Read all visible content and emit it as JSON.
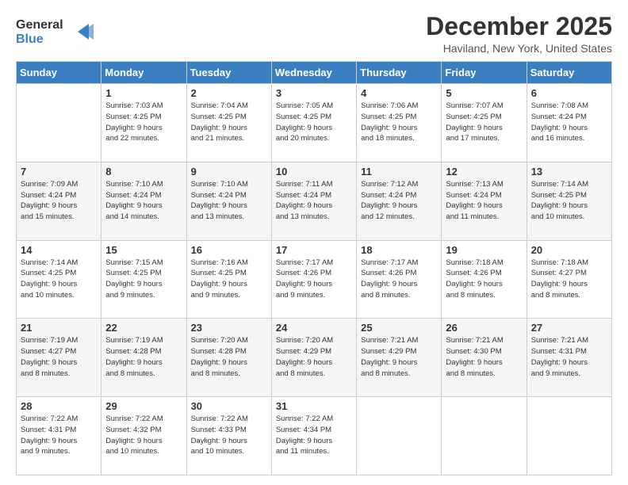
{
  "logo": {
    "line1": "General",
    "line2": "Blue"
  },
  "title": "December 2025",
  "subtitle": "Haviland, New York, United States",
  "days_of_week": [
    "Sunday",
    "Monday",
    "Tuesday",
    "Wednesday",
    "Thursday",
    "Friday",
    "Saturday"
  ],
  "weeks": [
    [
      {
        "day": "",
        "info": ""
      },
      {
        "day": "1",
        "info": "Sunrise: 7:03 AM\nSunset: 4:25 PM\nDaylight: 9 hours\nand 22 minutes."
      },
      {
        "day": "2",
        "info": "Sunrise: 7:04 AM\nSunset: 4:25 PM\nDaylight: 9 hours\nand 21 minutes."
      },
      {
        "day": "3",
        "info": "Sunrise: 7:05 AM\nSunset: 4:25 PM\nDaylight: 9 hours\nand 20 minutes."
      },
      {
        "day": "4",
        "info": "Sunrise: 7:06 AM\nSunset: 4:25 PM\nDaylight: 9 hours\nand 18 minutes."
      },
      {
        "day": "5",
        "info": "Sunrise: 7:07 AM\nSunset: 4:25 PM\nDaylight: 9 hours\nand 17 minutes."
      },
      {
        "day": "6",
        "info": "Sunrise: 7:08 AM\nSunset: 4:24 PM\nDaylight: 9 hours\nand 16 minutes."
      }
    ],
    [
      {
        "day": "7",
        "info": "Sunrise: 7:09 AM\nSunset: 4:24 PM\nDaylight: 9 hours\nand 15 minutes."
      },
      {
        "day": "8",
        "info": "Sunrise: 7:10 AM\nSunset: 4:24 PM\nDaylight: 9 hours\nand 14 minutes."
      },
      {
        "day": "9",
        "info": "Sunrise: 7:10 AM\nSunset: 4:24 PM\nDaylight: 9 hours\nand 13 minutes."
      },
      {
        "day": "10",
        "info": "Sunrise: 7:11 AM\nSunset: 4:24 PM\nDaylight: 9 hours\nand 13 minutes."
      },
      {
        "day": "11",
        "info": "Sunrise: 7:12 AM\nSunset: 4:24 PM\nDaylight: 9 hours\nand 12 minutes."
      },
      {
        "day": "12",
        "info": "Sunrise: 7:13 AM\nSunset: 4:24 PM\nDaylight: 9 hours\nand 11 minutes."
      },
      {
        "day": "13",
        "info": "Sunrise: 7:14 AM\nSunset: 4:25 PM\nDaylight: 9 hours\nand 10 minutes."
      }
    ],
    [
      {
        "day": "14",
        "info": "Sunrise: 7:14 AM\nSunset: 4:25 PM\nDaylight: 9 hours\nand 10 minutes."
      },
      {
        "day": "15",
        "info": "Sunrise: 7:15 AM\nSunset: 4:25 PM\nDaylight: 9 hours\nand 9 minutes."
      },
      {
        "day": "16",
        "info": "Sunrise: 7:16 AM\nSunset: 4:25 PM\nDaylight: 9 hours\nand 9 minutes."
      },
      {
        "day": "17",
        "info": "Sunrise: 7:17 AM\nSunset: 4:26 PM\nDaylight: 9 hours\nand 9 minutes."
      },
      {
        "day": "18",
        "info": "Sunrise: 7:17 AM\nSunset: 4:26 PM\nDaylight: 9 hours\nand 8 minutes."
      },
      {
        "day": "19",
        "info": "Sunrise: 7:18 AM\nSunset: 4:26 PM\nDaylight: 9 hours\nand 8 minutes."
      },
      {
        "day": "20",
        "info": "Sunrise: 7:18 AM\nSunset: 4:27 PM\nDaylight: 9 hours\nand 8 minutes."
      }
    ],
    [
      {
        "day": "21",
        "info": "Sunrise: 7:19 AM\nSunset: 4:27 PM\nDaylight: 9 hours\nand 8 minutes."
      },
      {
        "day": "22",
        "info": "Sunrise: 7:19 AM\nSunset: 4:28 PM\nDaylight: 9 hours\nand 8 minutes."
      },
      {
        "day": "23",
        "info": "Sunrise: 7:20 AM\nSunset: 4:28 PM\nDaylight: 9 hours\nand 8 minutes."
      },
      {
        "day": "24",
        "info": "Sunrise: 7:20 AM\nSunset: 4:29 PM\nDaylight: 9 hours\nand 8 minutes."
      },
      {
        "day": "25",
        "info": "Sunrise: 7:21 AM\nSunset: 4:29 PM\nDaylight: 9 hours\nand 8 minutes."
      },
      {
        "day": "26",
        "info": "Sunrise: 7:21 AM\nSunset: 4:30 PM\nDaylight: 9 hours\nand 8 minutes."
      },
      {
        "day": "27",
        "info": "Sunrise: 7:21 AM\nSunset: 4:31 PM\nDaylight: 9 hours\nand 9 minutes."
      }
    ],
    [
      {
        "day": "28",
        "info": "Sunrise: 7:22 AM\nSunset: 4:31 PM\nDaylight: 9 hours\nand 9 minutes."
      },
      {
        "day": "29",
        "info": "Sunrise: 7:22 AM\nSunset: 4:32 PM\nDaylight: 9 hours\nand 10 minutes."
      },
      {
        "day": "30",
        "info": "Sunrise: 7:22 AM\nSunset: 4:33 PM\nDaylight: 9 hours\nand 10 minutes."
      },
      {
        "day": "31",
        "info": "Sunrise: 7:22 AM\nSunset: 4:34 PM\nDaylight: 9 hours\nand 11 minutes."
      },
      {
        "day": "",
        "info": ""
      },
      {
        "day": "",
        "info": ""
      },
      {
        "day": "",
        "info": ""
      }
    ]
  ]
}
